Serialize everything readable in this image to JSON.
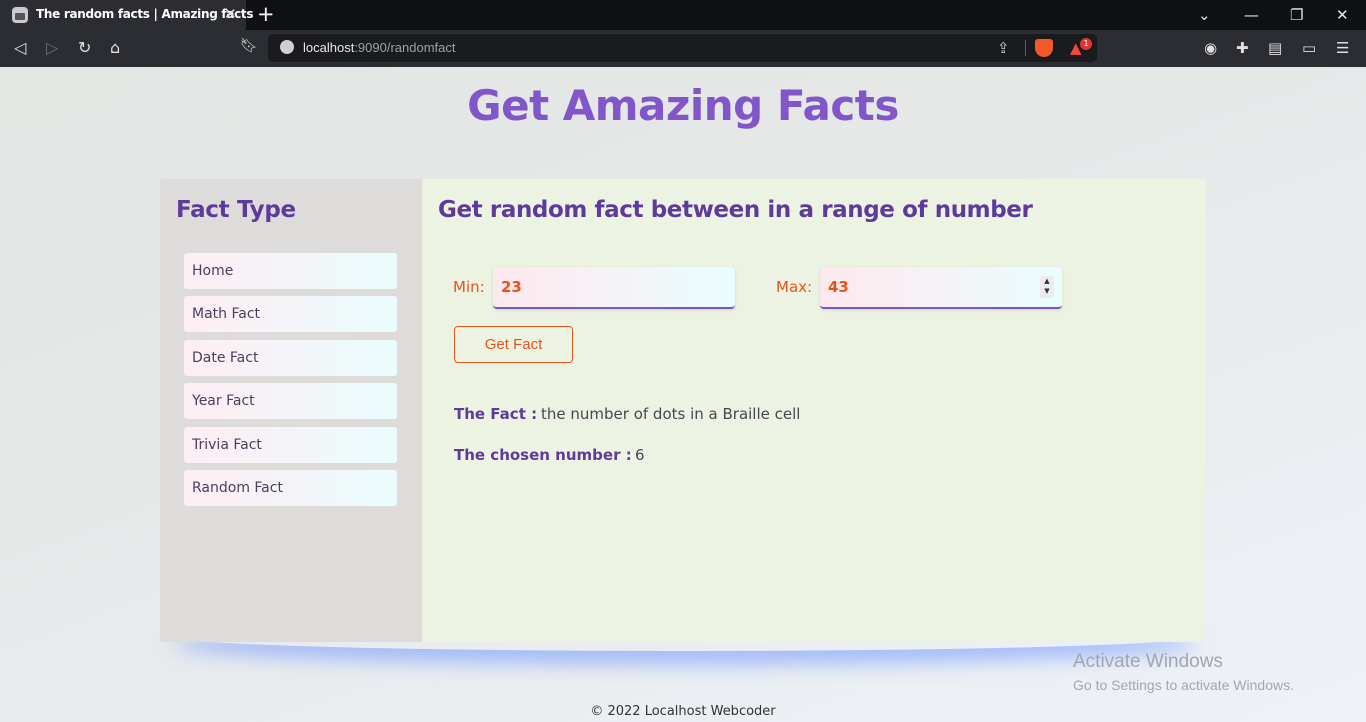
{
  "browser": {
    "tab_title": "The random facts | Amazing facts",
    "tab_close": "✕",
    "new_tab": "+",
    "url_host": "localhost",
    "url_rest": ":9090/randomfact",
    "rewards_count": "1"
  },
  "page": {
    "title": "Get Amazing Facts",
    "sidebar_title": "Fact Type",
    "nav_items": [
      "Home",
      "Math Fact",
      "Date Fact",
      "Year Fact",
      "Trivia Fact",
      "Random Fact"
    ],
    "main_title": "Get random fact between in a range of number",
    "min_label": "Min:",
    "min_value": "23",
    "max_label": "Max:",
    "max_value": "43",
    "button_label": "Get Fact",
    "fact_label": "The Fact :",
    "fact_value": "the number of dots in a Braille cell",
    "number_label": "The chosen number :",
    "number_value": "6",
    "footer": "© 2022 Localhost Webcoder"
  },
  "overlay": {
    "activate_title": "Activate Windows",
    "activate_sub": "Go to Settings to activate Windows."
  },
  "colors": {
    "heading": "#8156c9",
    "accent_orange": "#e8531c",
    "sidebar_bg": "#dddcdb",
    "main_bg": "#edf3e2"
  }
}
